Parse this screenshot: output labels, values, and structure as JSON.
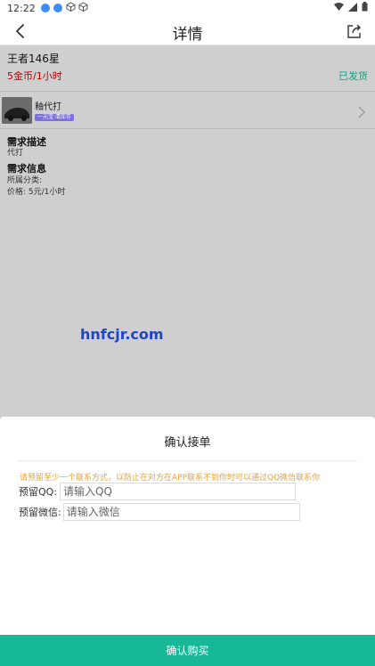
{
  "status_bar": {
    "time": "12:22",
    "icons": [
      "notification-blue-icon",
      "notification-blue-icon",
      "cube-icon",
      "cube-icon",
      "wifi-icon",
      "signal-icon",
      "battery-icon"
    ]
  },
  "app_bar": {
    "title": "详情",
    "back_icon": "chevron-left-icon",
    "share_icon": "share-icon"
  },
  "order": {
    "name": "王者146星",
    "price": "5金币/1小时",
    "status": "已发货",
    "colors": {
      "price": "#c40000",
      "status": "#1a9c86"
    }
  },
  "user": {
    "username": "釉代打",
    "badge": "一元宝·清库存"
  },
  "details": {
    "desc_title": "需求描述",
    "desc_text": "代打",
    "info_title": "需求信息",
    "category": "所属分类:",
    "price_line": "价格: 5元/1小时"
  },
  "watermark": "hnfcjr.com",
  "sheet": {
    "title": "确认接单",
    "notice": "请预留至少一个联系方式，以防止在对方在APP联系不到你时可以通过QQ微信联系你",
    "qq_label": "预留QQ:",
    "qq_placeholder": "请输入QQ",
    "wechat_label": "预留微信:",
    "wechat_placeholder": "请输入微信"
  },
  "buy_button": "确认购买",
  "accent_color": "#17b897"
}
